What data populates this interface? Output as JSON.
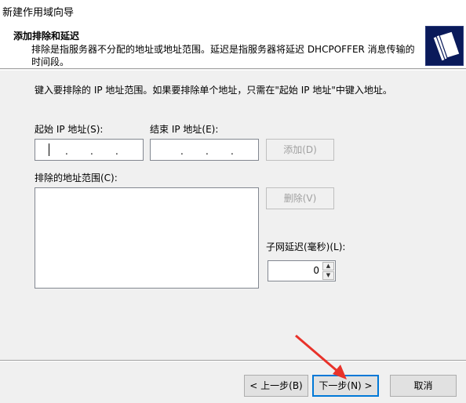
{
  "window": {
    "title": "新建作用域向导"
  },
  "header": {
    "title": "添加排除和延迟",
    "description": "排除是指服务器不分配的地址或地址范围。延迟是指服务器将延迟 DHCPOFFER 消息传输的时间段。",
    "icon": "folder-stack-icon"
  },
  "form": {
    "instruction": "键入要排除的 IP 地址范围。如果要排除单个地址，只需在\"起始 IP 地址\"中键入地址。",
    "start_ip_label": "起始 IP 地址(S):",
    "end_ip_label": "结束 IP 地址(E):",
    "add_label": "添加(D)",
    "excluded_label": "排除的地址范围(C):",
    "delete_label": "删除(V)",
    "delay_label": "子网延迟(毫秒)(L):",
    "delay_value": "0"
  },
  "footer": {
    "back_label": "< 上一步(B)",
    "next_label": "下一步(N) >",
    "cancel_label": "取消"
  },
  "colors": {
    "annotation_arrow": "#e8322a",
    "focus_border": "#0078d7"
  }
}
